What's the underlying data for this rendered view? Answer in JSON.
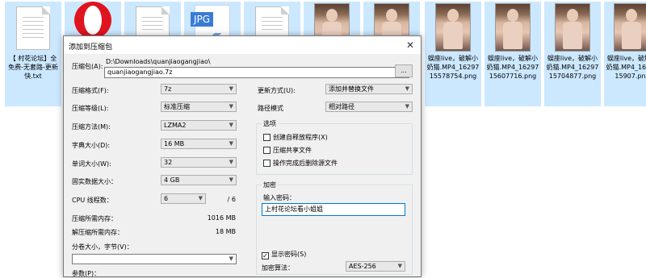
{
  "files": [
    {
      "name": "【 村花论坛】全免费-无套路-更新快.txt",
      "icon": "text-document-icon"
    },
    {
      "name": "",
      "icon": "opera-icon"
    },
    {
      "name": "",
      "icon": "text-document-icon"
    },
    {
      "name": "",
      "icon": "jpg-file-icon",
      "tag": "JPG"
    },
    {
      "name": "",
      "icon": "text-document-icon"
    },
    {
      "name": "",
      "icon": "photo-thumbnail-icon"
    },
    {
      "name": "",
      "icon": "photo-thumbnail-icon"
    },
    {
      "name": "蜈座live，破解小奶猫.MP4_1629715578754.png",
      "icon": "photo-thumbnail-icon"
    },
    {
      "name": "蜈座live，破解小奶猫.MP4_1629715607716.png",
      "icon": "photo-thumbnail-icon"
    },
    {
      "name": "蜈座live，破解小奶猫.MP4_1629715704877.png",
      "icon": "photo-thumbnail-icon"
    },
    {
      "name": "蜈座live，破解小奶猫.MP4_1629715907.png",
      "icon": "photo-thumbnail-icon"
    }
  ],
  "dialog": {
    "title": "添加到压缩包",
    "close": "✕",
    "archive": {
      "label": "压缩包(A):",
      "path": "D:\\Downloads\\quanjiaogangjiao\\",
      "value": "quanjiaogangjiao.7z",
      "browse": "..."
    },
    "format": {
      "label": "压缩格式(F):",
      "value": "7z"
    },
    "level": {
      "label": "压缩等级(L):",
      "value": "标准压缩"
    },
    "method": {
      "label": "压缩方法(M):",
      "value": "LZMA2"
    },
    "dict": {
      "label": "字典大小(D):",
      "value": "16 MB"
    },
    "word": {
      "label": "单词大小(W):",
      "value": "32"
    },
    "solid": {
      "label": "固实数据大小：",
      "value": "4 GB"
    },
    "cpu": {
      "label": "CPU 线程数：",
      "value": "6",
      "total": "/ 6"
    },
    "mem_compress": {
      "label": "压缩所需内存：",
      "value": "1016 MB"
    },
    "mem_decompress": {
      "label": "解压缩所需内存：",
      "value": "18 MB"
    },
    "split": {
      "label": "分卷大小，字节(V)：",
      "value": ""
    },
    "params": {
      "label": "参数(P)："
    },
    "update": {
      "label": "更新方式(U):",
      "value": "添加并替换文件"
    },
    "pathmode": {
      "label": "路径模式",
      "value": "相对路径"
    },
    "options": {
      "title": "选项",
      "sfx": "创建自释放程序(X)",
      "shared": "压缩共享文件",
      "delete": "操作完成后删除源文件"
    },
    "encryption": {
      "title": "加密",
      "pwd_label": "输入密码：",
      "pwd_value": "上村花论坛看小姐姐",
      "show_pwd": "显示密码(S)",
      "method_label": "加密算法：",
      "method_value": "AES-256"
    }
  }
}
